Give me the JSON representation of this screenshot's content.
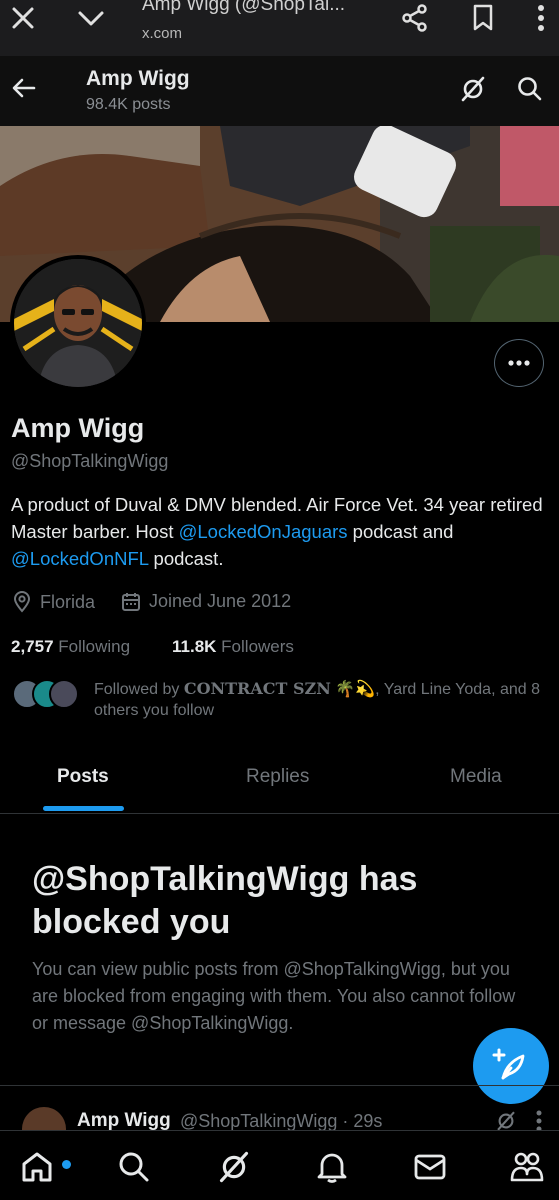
{
  "browser": {
    "tab_title": "Amp Wigg (@ShopTal...",
    "url": "x.com",
    "icons": [
      "close-icon",
      "chevron-down-icon",
      "share-icon",
      "bookmark-icon",
      "more-vertical-icon"
    ]
  },
  "header": {
    "name": "Amp Wigg",
    "post_count": "98.4K posts"
  },
  "profile": {
    "name": "Amp Wigg",
    "handle": "@ShopTalkingWigg",
    "bio_text_1": "A product of Duval & DMV blended. Air Force Vet. 34 year retired Master barber. Host ",
    "bio_link_1": "@LockedOnJaguars",
    "bio_text_2": " podcast and ",
    "bio_link_2": "@LockedOnNFL",
    "bio_text_3": " podcast.",
    "location": "Florida",
    "joined": "Joined June 2012",
    "following_count": "2,757",
    "following_label": "Following",
    "followers_count": "11.8K",
    "followers_label": "Followers",
    "followed_by_prefix": "Followed by ",
    "followed_by_name": "CONTRACT SZN",
    "followed_by_emoji": "🌴💫",
    "followed_by_rest": ", Yard Line Yoda, and 8 others you follow"
  },
  "tabs": [
    {
      "label": "Posts",
      "active": true
    },
    {
      "label": "Replies",
      "active": false
    },
    {
      "label": "Media",
      "active": false
    }
  ],
  "blocked": {
    "title": "@ShopTalkingWigg has blocked you",
    "body": "You can view public posts from @ShopTalkingWigg, but you are blocked from engaging with them. You also cannot follow or message @ShopTalkingWigg."
  },
  "post_preview": {
    "name": "Amp Wigg",
    "handle_time": "@ShopTalkingWigg · 29s"
  },
  "colors": {
    "accent": "#1d9bf0",
    "background": "#000000",
    "muted": "#71767b"
  },
  "bottom_nav": [
    "home-icon",
    "search-icon",
    "grok-icon",
    "notifications-icon",
    "messages-icon",
    "communities-icon"
  ]
}
